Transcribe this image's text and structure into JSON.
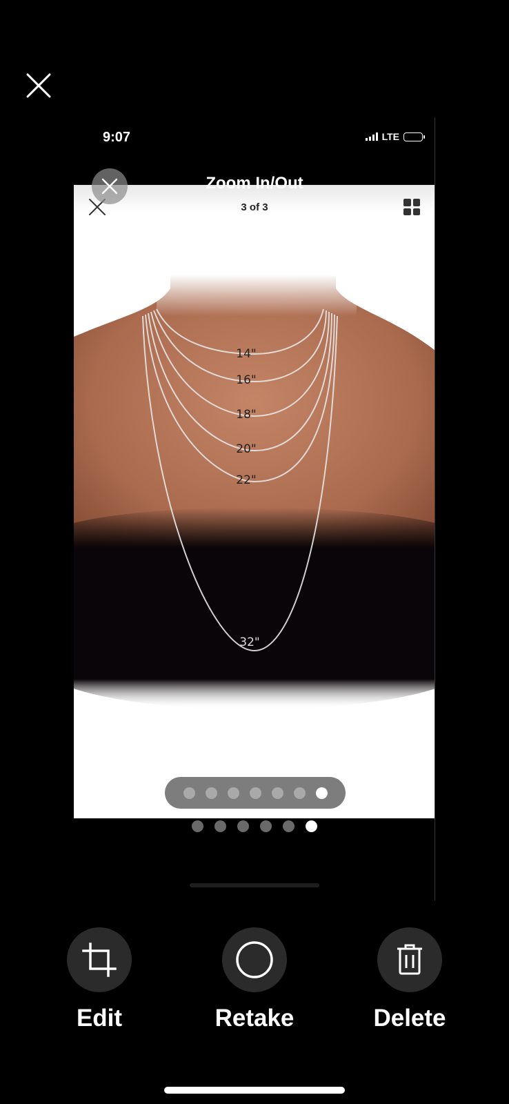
{
  "screenshot": {
    "status_bar": {
      "time": "9:07",
      "network": "LTE"
    },
    "viewer": {
      "title": "Zoom In/Out",
      "counter": "3 of 3",
      "chain_lengths": [
        "14\"",
        "16\"",
        "18\"",
        "20\"",
        "22\"",
        "32\""
      ],
      "page_dots": {
        "count": 7,
        "active_index": 6
      }
    },
    "outer_dots": {
      "count": 6,
      "active_index": 5
    }
  },
  "actions": {
    "edit": {
      "label": "Edit",
      "icon": "crop-icon"
    },
    "retake": {
      "label": "Retake",
      "icon": "circle-icon"
    },
    "delete": {
      "label": "Delete",
      "icon": "trash-icon"
    }
  }
}
